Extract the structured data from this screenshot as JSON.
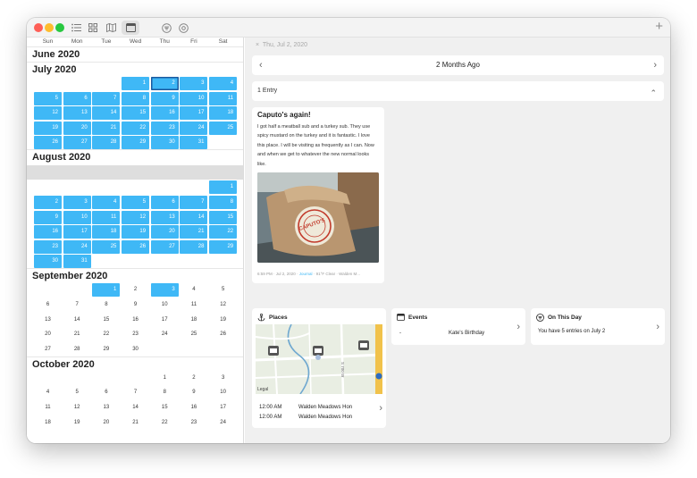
{
  "window": {
    "lights": [
      "#fe5f57",
      "#febc2e",
      "#28c840"
    ],
    "toolbar_icons": [
      "list-icon",
      "grid-icon",
      "map-icon",
      "calendar-icon",
      "filter-icon",
      "at-icon"
    ],
    "new_entry": "+"
  },
  "calendar": {
    "weekdays": [
      "Sun",
      "Mon",
      "Tue",
      "Wed",
      "Thu",
      "Fri",
      "Sat"
    ],
    "entry_color": "#3fb8f6",
    "months": [
      {
        "title": "June 2020",
        "offset": 1,
        "length": 0,
        "entries": [],
        "selected": null
      },
      {
        "title": "July 2020",
        "offset": 3,
        "length": 31,
        "entries": [
          1,
          2,
          3,
          4,
          5,
          6,
          7,
          8,
          9,
          10,
          11,
          12,
          13,
          14,
          15,
          16,
          17,
          18,
          19,
          20,
          21,
          22,
          23,
          24,
          25,
          26,
          27,
          28,
          29,
          30,
          31
        ],
        "selected": 2
      },
      {
        "title": "August 2020",
        "offset": 6,
        "length": 31,
        "entries": [
          1,
          2,
          3,
          4,
          5,
          6,
          7,
          8,
          9,
          10,
          11,
          12,
          13,
          14,
          15,
          16,
          17,
          18,
          19,
          20,
          21,
          22,
          23,
          24,
          25,
          26,
          27,
          28,
          29,
          30,
          31
        ],
        "selected": null,
        "band_before": true
      },
      {
        "title": "September 2020",
        "offset": 2,
        "length": 30,
        "entries": [
          1,
          3
        ],
        "selected": null
      },
      {
        "title": "October 2020",
        "offset": 4,
        "length": 24,
        "entries": [],
        "selected": null
      }
    ]
  },
  "detail": {
    "date_line": "Thu, Jul 2, 2020",
    "close_icon": "×",
    "nav_label": "2 Months Ago",
    "prev": "‹",
    "next": "›",
    "entry_count": "1 Entry",
    "collapse": "⌃",
    "entry": {
      "title": "Caputo's again!",
      "body": "I got half a meatball sub and a turkey sub. They use spicy mustard on the turkey and it is fantastic. I love this place. I will be visiting as frequently as I can. Now and when we get to whatever the new normal looks like.",
      "photo_label": "CAPUTO'S",
      "time": "6:59 PM",
      "date": "Jul 2, 2020",
      "journal": "Journal",
      "weather": "91°F Clear",
      "location": "Walden M...",
      "sep": " · "
    },
    "places": {
      "title": "Places",
      "map_label": "Legal",
      "road_label": "S 700 W",
      "rows": [
        {
          "time": "12:00 AM",
          "place": "Walden Meadows Hon"
        },
        {
          "time": "12:00 AM",
          "place": "Walden Meadows Hon"
        }
      ],
      "chevron": "›"
    },
    "events": {
      "title": "Events",
      "rows": [
        {
          "bullet": "-",
          "name": "Kate's Birthday"
        }
      ],
      "chevron": "›"
    },
    "on_this_day": {
      "title": "On This Day",
      "text": "You have 5 entries on July 2",
      "chevron": "›"
    }
  }
}
